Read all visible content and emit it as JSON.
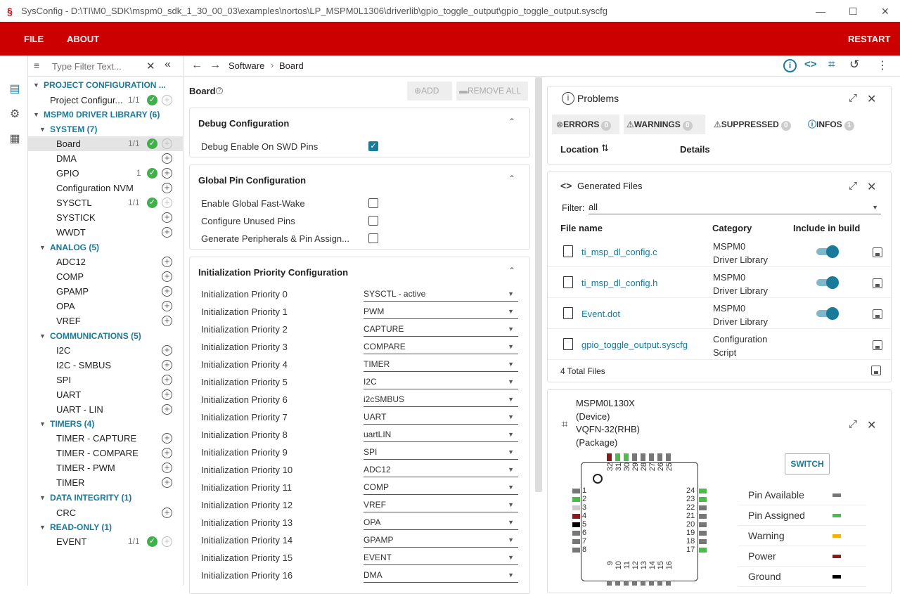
{
  "window": {
    "title": "SysConfig - D:\\TI\\M0_SDK\\mspm0_sdk_1_30_00_03\\examples\\nortos\\LP_MSPM0L1306\\driverlib\\gpio_toggle_output\\gpio_toggle_output.syscfg"
  },
  "menu": {
    "file": "FILE",
    "about": "ABOUT",
    "restart": "RESTART"
  },
  "filter": {
    "placeholder": "Type Filter Text..."
  },
  "tree": {
    "project_config": "PROJECT CONFIGURATION ...",
    "project_item": "Project Configur...",
    "project_count": "1/1",
    "driver_lib": "MSPM0 DRIVER LIBRARY (6)",
    "system": "SYSTEM (7)",
    "system_items": [
      {
        "label": "Board",
        "count": "1/1"
      },
      {
        "label": "DMA",
        "count": ""
      },
      {
        "label": "GPIO",
        "count": "1"
      },
      {
        "label": "Configuration NVM",
        "count": ""
      },
      {
        "label": "SYSCTL",
        "count": "1/1"
      },
      {
        "label": "SYSTICK",
        "count": ""
      },
      {
        "label": "WWDT",
        "count": ""
      }
    ],
    "analog": "ANALOG (5)",
    "analog_items": [
      "ADC12",
      "COMP",
      "GPAMP",
      "OPA",
      "VREF"
    ],
    "comms": "COMMUNICATIONS (5)",
    "comms_items": [
      "I2C",
      "I2C - SMBUS",
      "SPI",
      "UART",
      "UART - LIN"
    ],
    "timers": "TIMERS (4)",
    "timers_items": [
      "TIMER - CAPTURE",
      "TIMER - COMPARE",
      "TIMER - PWM",
      "TIMER"
    ],
    "integrity": "DATA INTEGRITY (1)",
    "integrity_items": [
      "CRC"
    ],
    "readonly": "READ-ONLY (1)",
    "readonly_item": "EVENT",
    "readonly_count": "1/1"
  },
  "breadcrumb": {
    "software": "Software",
    "sep": "›",
    "board": "Board"
  },
  "board": {
    "title": "Board",
    "add": "ADD",
    "remove_all": "REMOVE ALL",
    "debug": {
      "title": "Debug Configuration",
      "item": "Debug Enable On SWD Pins",
      "checked": true
    },
    "global": {
      "title": "Global Pin Configuration",
      "items": [
        "Enable Global Fast-Wake",
        "Configure Unused Pins",
        "Generate Peripherals & Pin Assign..."
      ]
    },
    "init": {
      "title": "Initialization Priority Configuration",
      "rows": [
        {
          "label": "Initialization Priority 0",
          "value": "SYSCTL - active"
        },
        {
          "label": "Initialization Priority 1",
          "value": "PWM"
        },
        {
          "label": "Initialization Priority 2",
          "value": "CAPTURE"
        },
        {
          "label": "Initialization Priority 3",
          "value": "COMPARE"
        },
        {
          "label": "Initialization Priority 4",
          "value": "TIMER"
        },
        {
          "label": "Initialization Priority 5",
          "value": "I2C"
        },
        {
          "label": "Initialization Priority 6",
          "value": "i2cSMBUS"
        },
        {
          "label": "Initialization Priority 7",
          "value": "UART"
        },
        {
          "label": "Initialization Priority 8",
          "value": "uartLIN"
        },
        {
          "label": "Initialization Priority 9",
          "value": "SPI"
        },
        {
          "label": "Initialization Priority 10",
          "value": "ADC12"
        },
        {
          "label": "Initialization Priority 11",
          "value": "COMP"
        },
        {
          "label": "Initialization Priority 12",
          "value": "VREF"
        },
        {
          "label": "Initialization Priority 13",
          "value": "OPA"
        },
        {
          "label": "Initialization Priority 14",
          "value": "GPAMP"
        },
        {
          "label": "Initialization Priority 15",
          "value": "EVENT"
        },
        {
          "label": "Initialization Priority 16",
          "value": "DMA"
        }
      ]
    }
  },
  "problems": {
    "title": "Problems",
    "errors": "ERRORS",
    "errors_count": "0",
    "warnings": "WARNINGS",
    "warnings_count": "0",
    "suppressed": "SUPPRESSED",
    "suppressed_count": "0",
    "infos": "INFOS",
    "infos_count": "1",
    "col_location": "Location",
    "col_details": "Details"
  },
  "generated": {
    "title": "Generated Files",
    "filter_label": "Filter:",
    "filter_value": "all",
    "col_file": "File name",
    "col_category": "Category",
    "col_include": "Include in build",
    "files": [
      {
        "name": "ti_msp_dl_config.c",
        "cat1": "MSPM0",
        "cat2": "Driver Library"
      },
      {
        "name": "ti_msp_dl_config.h",
        "cat1": "MSPM0",
        "cat2": "Driver Library"
      },
      {
        "name": "Event.dot",
        "cat1": "MSPM0",
        "cat2": "Driver Library"
      },
      {
        "name": "gpio_toggle_output.syscfg",
        "cat1": "Configuration",
        "cat2": "Script"
      }
    ],
    "total": "4 Total Files"
  },
  "device": {
    "line1": "MSPM0L130X",
    "line2": "(Device)",
    "line3": "VQFN-32(RHB)",
    "line4": "(Package)",
    "switch": "SWITCH",
    "legend": [
      {
        "label": "Pin Available",
        "color": "#777777"
      },
      {
        "label": "Pin Assigned",
        "color": "#4cbb4c"
      },
      {
        "label": "Warning",
        "color": "#f0b400"
      },
      {
        "label": "Power",
        "color": "#8b1a1a"
      },
      {
        "label": "Ground",
        "color": "#000000"
      }
    ],
    "pins_left": [
      "1",
      "2",
      "3",
      "4",
      "5",
      "6",
      "7",
      "8"
    ],
    "pins_right": [
      "24",
      "23",
      "22",
      "21",
      "20",
      "19",
      "18",
      "17"
    ],
    "pins_top": [
      "32",
      "31",
      "30",
      "29",
      "28",
      "27",
      "26",
      "25"
    ],
    "pins_bottom": [
      "9",
      "10",
      "11",
      "12",
      "13",
      "14",
      "15",
      "16"
    ]
  },
  "colors": {
    "brand": "#cc0000",
    "accent": "#1a7a9a",
    "ok": "#3fb04a"
  }
}
